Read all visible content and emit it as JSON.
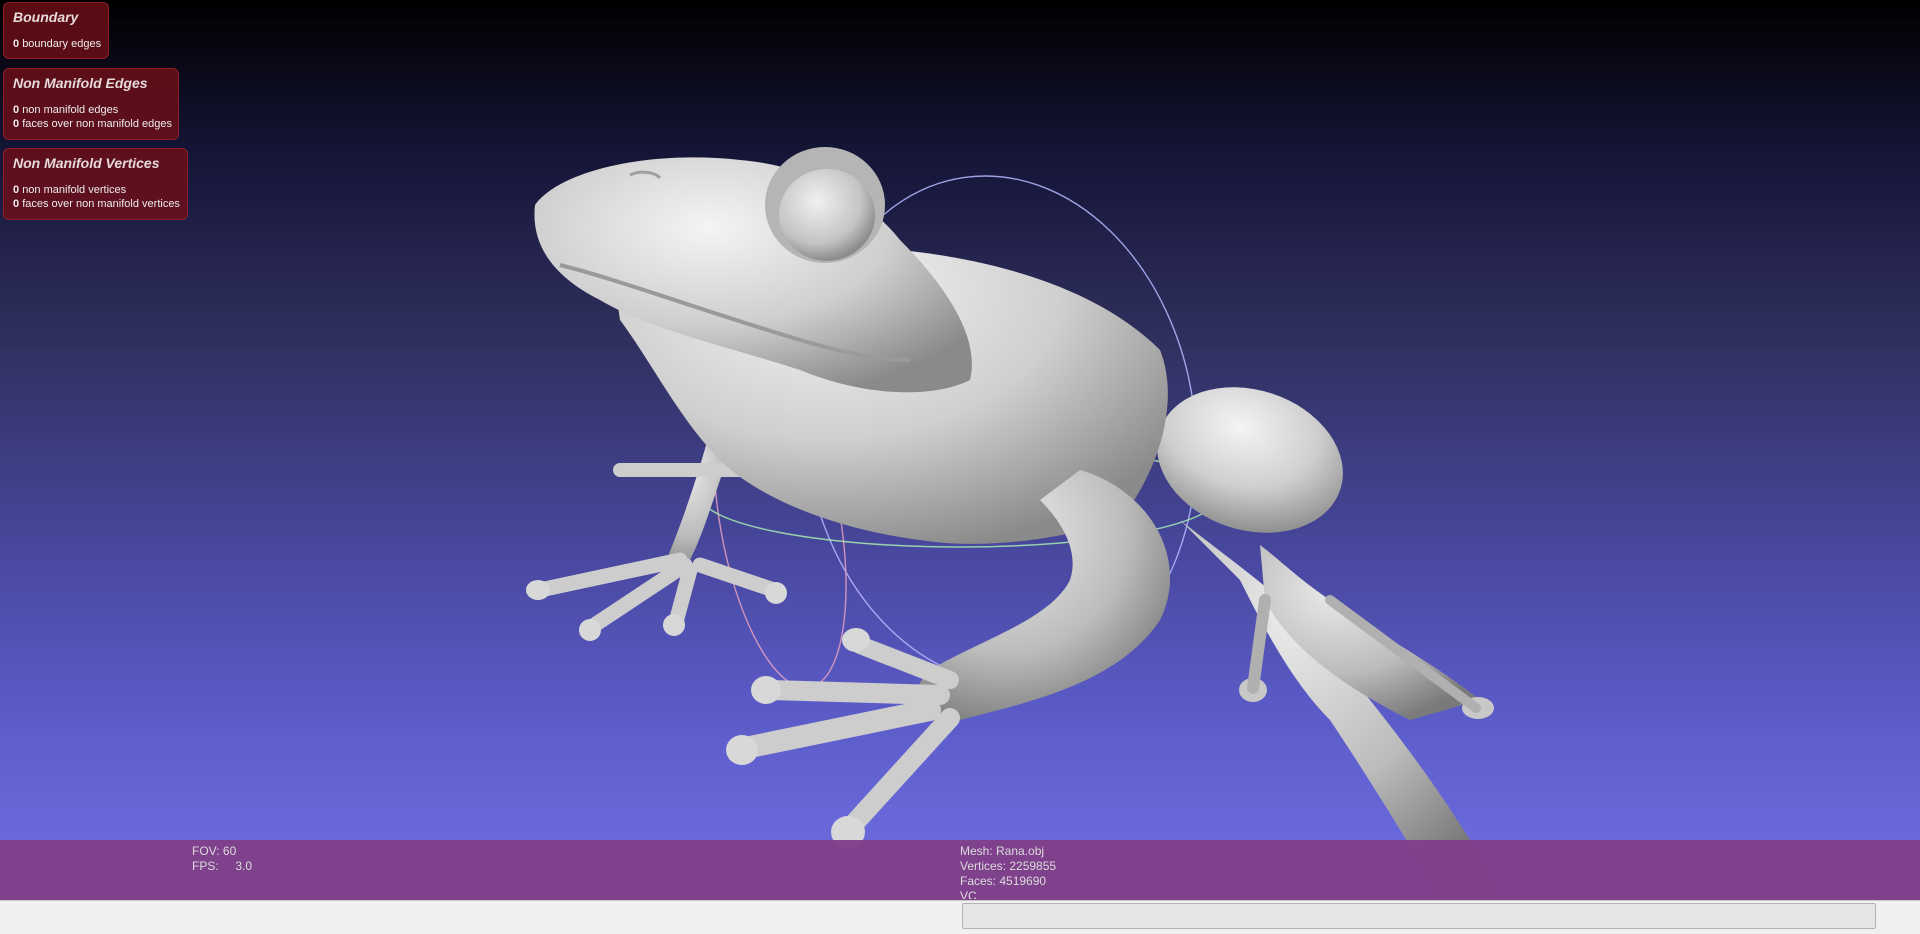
{
  "panels": {
    "boundary": {
      "title": "Boundary",
      "rows": [
        {
          "count": "0",
          "label": "boundary edges"
        }
      ]
    },
    "non_manifold_edges": {
      "title": "Non Manifold Edges",
      "rows": [
        {
          "count": "0",
          "label": "non manifold edges"
        },
        {
          "count": "0",
          "label": "faces over non manifold edges"
        }
      ]
    },
    "non_manifold_vertices": {
      "title": "Non Manifold Vertices",
      "rows": [
        {
          "count": "0",
          "label": "non manifold vertices"
        },
        {
          "count": "0",
          "label": "faces over non manifold vertices"
        }
      ]
    }
  },
  "status": {
    "fov": "FOV: 60",
    "fps": "FPS:     3.0",
    "mesh": "Mesh: Rana.obj",
    "vertices": "Vertices: 2259855",
    "faces": "Faces: 4519690",
    "vc": "VC"
  },
  "progress": {
    "value": 0
  },
  "scene": {
    "background_top": "#000000",
    "background_bottom": "#7070e6",
    "mesh_color": "#c9c9c9",
    "trackball_colors": [
      "#b8b8ff",
      "#e8a0c0",
      "#a8e8b0"
    ],
    "object": "frog-model"
  }
}
